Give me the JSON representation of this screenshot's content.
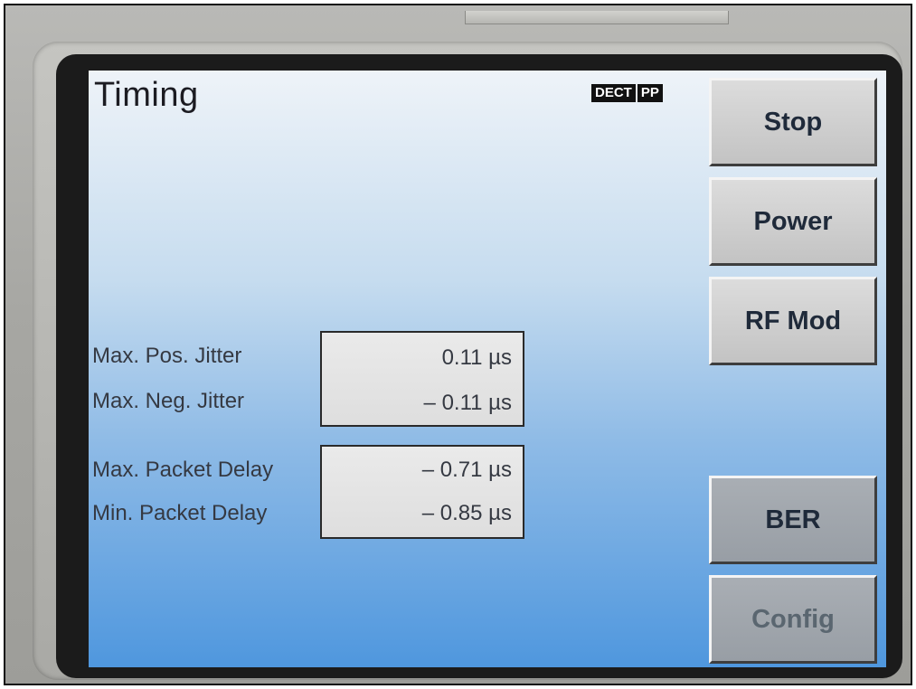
{
  "screen": {
    "title": "Timing",
    "mode_badge": [
      "DECT",
      "PP"
    ]
  },
  "measurements": {
    "jitter": [
      {
        "label": "Max. Pos. Jitter",
        "value": "0.11 µs"
      },
      {
        "label": "Max. Neg. Jitter",
        "value": "– 0.11 µs"
      }
    ],
    "delay": [
      {
        "label": "Max. Packet Delay",
        "value": "– 0.71 µs"
      },
      {
        "label": "Min. Packet Delay",
        "value": "– 0.85 µs"
      }
    ]
  },
  "softkeys": {
    "stop": "Stop",
    "power": "Power",
    "rf_mod": "RF Mod",
    "ber": "BER",
    "config": "Config"
  }
}
